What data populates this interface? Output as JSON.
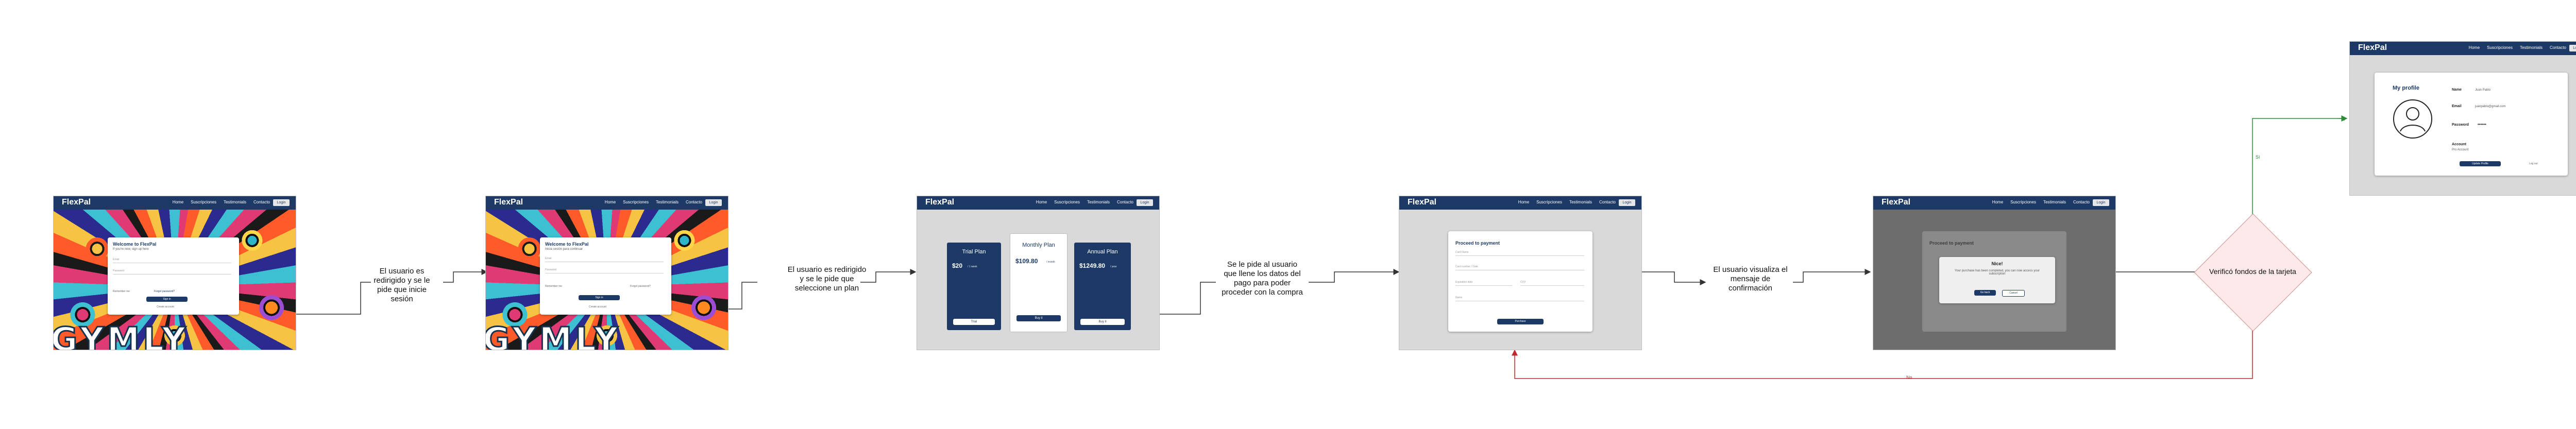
{
  "nav": {
    "brand": "FlexPal",
    "links": [
      "Home",
      "Suscripciones",
      "Testimonials",
      "Contacto"
    ],
    "login": "Login"
  },
  "art_text": "GYMLY",
  "login_card": {
    "title": "Welcome to FlexPal",
    "subtitle_1": "If you're new, sign up here",
    "subtitle_2": "Inicia sesión para continuar",
    "email": "Email",
    "password": "Password",
    "remember": "Remember me",
    "forgot": "Forgot password?",
    "button": "Sign in",
    "footer": "Create account"
  },
  "steps": {
    "s1": "El usuario es\nredirigido y se le\npide que inicie\nsesión",
    "s2": "El usuario es redirigido\ny se le pide que\nseleccione un plan",
    "s3": "Se le pide al usuario\nque llene los datos del\npago para poder\nproceder con la compra",
    "s4": "El usuario visualiza el\nmensaje de\nconfirmación",
    "decision": "Verificó fondos de la tarjeta"
  },
  "plans": [
    {
      "name": "Trial Plan",
      "price": "$20",
      "per": "/ 1 week",
      "button": "Trial"
    },
    {
      "name": "Monthly Plan",
      "price": "$109.80",
      "per": "/ month",
      "button": "Buy it"
    },
    {
      "name": "Annual Plan",
      "price": "$1249.80",
      "per": "/ year",
      "button": "Buy it"
    }
  ],
  "payment": {
    "title": "Proceed to payment",
    "fields": [
      "Card Name",
      "Card number / Date",
      "Expiration date",
      "CVV",
      "Name"
    ],
    "button": "Purchase"
  },
  "confirm": {
    "title": "Proceed to payment",
    "dialog_title": "Nice!",
    "dialog_text": "Your purchase has been completed, you can now access your subscription",
    "ok": "Go back",
    "cancel": "Cancel"
  },
  "profile": {
    "title": "My profile",
    "name_label": "Name",
    "name_value": "Juan Pablo",
    "email_label": "Email",
    "email_value": "juanpablo@gmail.com",
    "password_label": "Password",
    "password_value": "••••••",
    "account_label": "Account",
    "account_value": "Pro Account",
    "primary_button": "Update Profile",
    "secondary_button": "Log out"
  },
  "branch_labels": {
    "no": "No",
    "yes": "Sí"
  },
  "colors": {
    "navy": "#1d3a66",
    "yes_arrow": "#2e8b3a",
    "no_arrow": "#c0282d",
    "diamond_fill": "#fde9ea"
  }
}
